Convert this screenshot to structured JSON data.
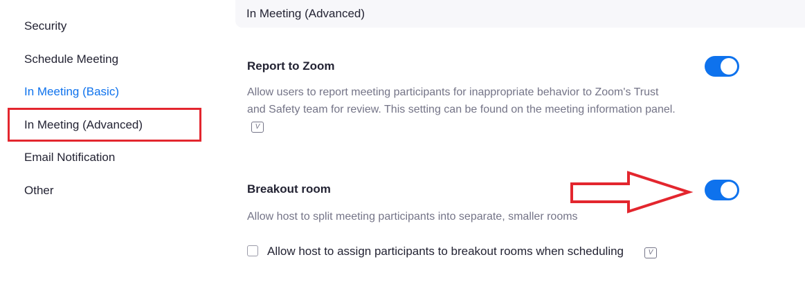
{
  "sidebar": {
    "items": [
      {
        "label": "Security"
      },
      {
        "label": "Schedule Meeting"
      },
      {
        "label": "In Meeting (Basic)"
      },
      {
        "label": "In Meeting (Advanced)"
      },
      {
        "label": "Email Notification"
      },
      {
        "label": "Other"
      }
    ]
  },
  "section": {
    "title": "In Meeting (Advanced)"
  },
  "settings": {
    "report": {
      "title": "Report to Zoom",
      "description": "Allow users to report meeting participants for inappropriate behavior to Zoom's Trust and Safety team for review. This setting can be found on the meeting information panel.",
      "enabled": true
    },
    "breakout": {
      "title": "Breakout room",
      "description": "Allow host to split meeting participants into separate, smaller rooms",
      "enabled": true,
      "option_label": "Allow host to assign participants to breakout rooms when scheduling",
      "option_checked": false
    }
  },
  "icons": {
    "version_icon_glyph": "V"
  },
  "colors": {
    "accent": "#0e72ed",
    "annotation": "#e3262e",
    "muted_text": "#747487"
  }
}
